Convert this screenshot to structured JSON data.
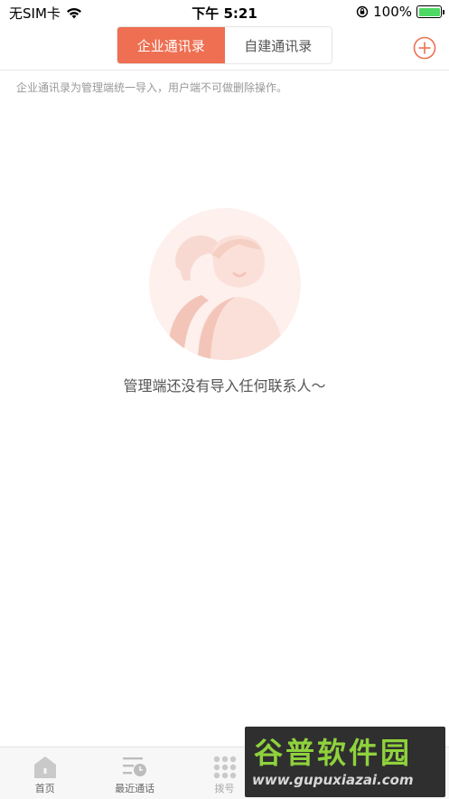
{
  "status_bar": {
    "carrier": "无SIM卡",
    "time": "下午 5:21",
    "battery_percent": "100%",
    "battery_level": 1.0
  },
  "header": {
    "tabs": [
      {
        "label": "企业通讯录",
        "active": true
      },
      {
        "label": "自建通讯录",
        "active": false
      }
    ],
    "add_icon": "plus-circle-icon"
  },
  "notice": "企业通讯录为管理端统一导入，用户端不可做删除操作。",
  "empty_state": {
    "icon": "contacts-empty-icon",
    "message": "管理端还没有导入任何联系人～"
  },
  "tab_bar": {
    "items": [
      {
        "label": "首页",
        "icon": "home-icon"
      },
      {
        "label": "最近通话",
        "icon": "recent-calls-icon"
      },
      {
        "label": "拨号",
        "icon": "dialpad-icon"
      },
      {
        "label": "",
        "icon": "contacts-icon"
      },
      {
        "label": "",
        "icon": "profile-icon"
      }
    ]
  },
  "watermark": {
    "title": "谷普软件园",
    "url": "www.gupuxiazai.com"
  },
  "colors": {
    "accent": "#ee6f52",
    "illustration_bg": "#fdf0ed"
  }
}
